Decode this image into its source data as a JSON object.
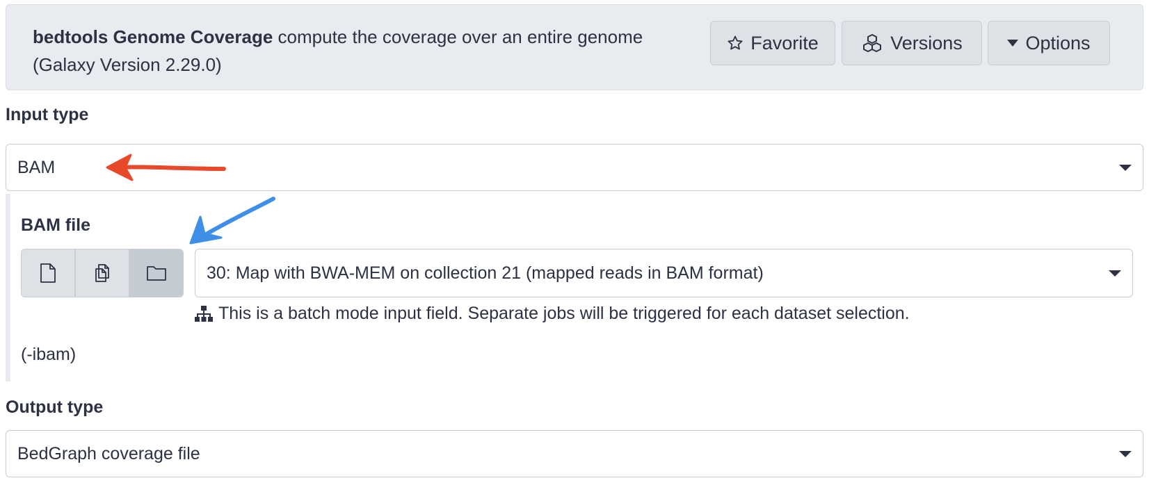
{
  "tool": {
    "name": "bedtools Genome Coverage",
    "description": "compute the coverage over an entire genome",
    "version": "(Galaxy Version 2.29.0)"
  },
  "header_buttons": {
    "favorite": {
      "label": "Favorite",
      "icon": "star-icon"
    },
    "versions": {
      "label": "Versions",
      "icon": "cubes-icon"
    },
    "options": {
      "label": "Options",
      "icon": "caret-down-icon"
    }
  },
  "input_type": {
    "label": "Input type",
    "value": "BAM"
  },
  "bam_file": {
    "label": "BAM file",
    "mode_buttons": [
      {
        "icon": "file-icon",
        "active": false
      },
      {
        "icon": "files-icon",
        "active": false
      },
      {
        "icon": "folder-icon",
        "active": true
      }
    ],
    "value": "30: Map with BWA-MEM on collection 21 (mapped reads in BAM format)",
    "help": "This is a batch mode input field. Separate jobs will be triggered for each dataset selection.",
    "help_icon": "sitemap-icon",
    "argument": "(-ibam)"
  },
  "output_type": {
    "label": "Output type",
    "value": "BedGraph coverage file"
  },
  "colors": {
    "header_bg": "#e8ebef",
    "text": "#2c3143",
    "annotation_red": "#e8492b",
    "annotation_blue": "#3f8fe8"
  }
}
